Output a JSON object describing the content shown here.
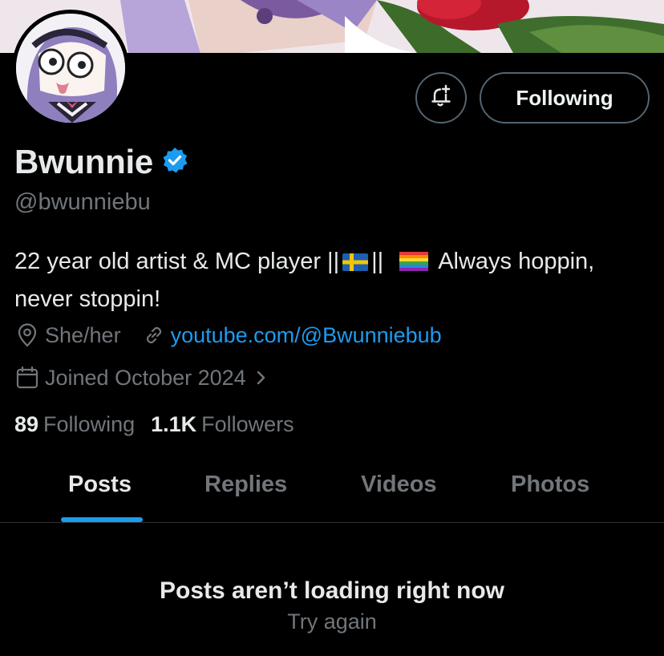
{
  "profile": {
    "display_name": "Bwunnie",
    "handle": "@bwunniebu",
    "verified": true,
    "bio_part1": "22 year old artist & MC player ||",
    "bio_sep": "||",
    "bio_part2": "Always hoppin,",
    "bio_line2": "never stoppin!",
    "pronouns": "She/her",
    "website": "youtube.com/@Bwunniebub",
    "joined": "Joined October 2024"
  },
  "actions": {
    "following_label": "Following"
  },
  "stats": {
    "following_count": "89",
    "following_label": "Following",
    "followers_count": "1.1K",
    "followers_label": "Followers"
  },
  "tabs": [
    {
      "label": "Posts",
      "active": true
    },
    {
      "label": "Replies",
      "active": false
    },
    {
      "label": "Videos",
      "active": false
    },
    {
      "label": "Photos",
      "active": false
    }
  ],
  "feed": {
    "error_title": "Posts aren’t loading right now",
    "retry_label": "Try again"
  },
  "colors": {
    "background": "#000000",
    "accent": "#1d9bf0",
    "muted_text": "#71767b",
    "primary_text": "#e7e9ea",
    "border": "#2f3336"
  },
  "icons": {
    "verified": "verified-badge-icon",
    "notify": "bell-plus-icon",
    "location": "location-pin-icon",
    "link": "link-icon",
    "calendar": "calendar-icon",
    "chevron": "chevron-right-icon"
  }
}
